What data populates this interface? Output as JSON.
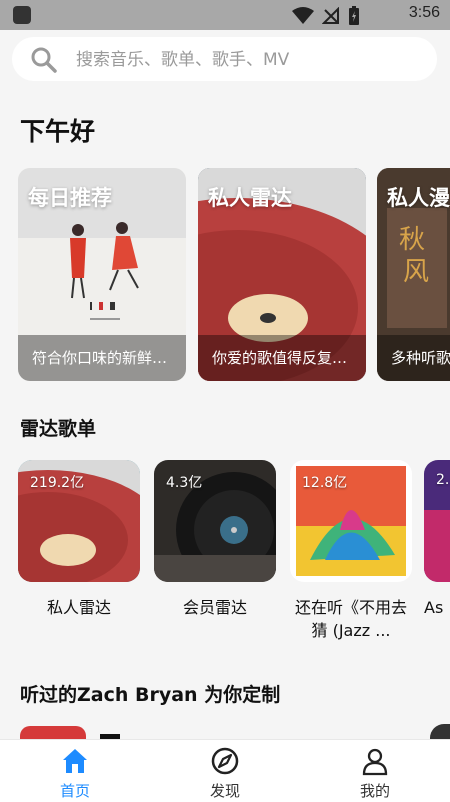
{
  "status_bar": {
    "time": "3:56"
  },
  "search": {
    "placeholder": "搜索音乐、歌单、歌手、MV"
  },
  "greeting": "下午好",
  "recommend": [
    {
      "title": "每日推荐",
      "desc": "符合你口味的新鲜…"
    },
    {
      "title": "私人雷达",
      "desc": "你爱的歌值得反复…"
    },
    {
      "title": "私人漫",
      "desc": "多种听歌"
    }
  ],
  "radar_section": {
    "title": "雷达歌单",
    "items": [
      {
        "count": "219.2亿",
        "name": "私人雷达"
      },
      {
        "count": "4.3亿",
        "name": "会员雷达"
      },
      {
        "count": "12.8亿",
        "name": "还在听《不用去猜 (Jazz ..."
      },
      {
        "count": "2.",
        "name": "As"
      }
    ]
  },
  "artist_section": {
    "title": "听过的Zach Bryan 为你定制"
  },
  "tabs": [
    {
      "label": "首页",
      "active": true
    },
    {
      "label": "发现",
      "active": false
    },
    {
      "label": "我的",
      "active": false
    }
  ],
  "colors": {
    "accent": "#1d8bff"
  }
}
